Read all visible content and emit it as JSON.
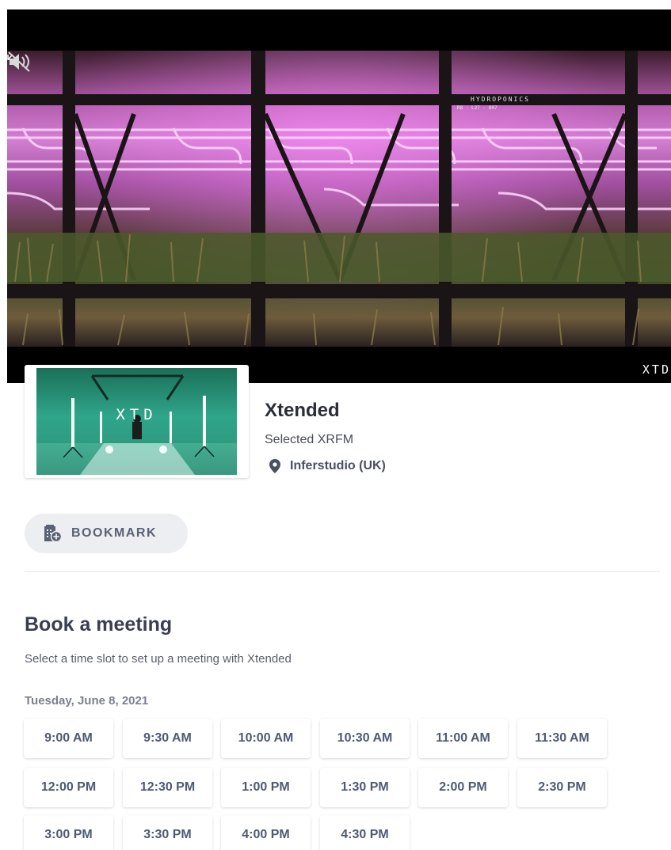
{
  "hero": {
    "video_overlay_text": "HYDROPONICS",
    "video_overlay_code": "R8 - L27 - 807",
    "brand_corner": "XTD"
  },
  "exhibitor": {
    "logo_text": "XTD",
    "name": "Xtended",
    "subtitle": "Selected XRFM",
    "location": "Inferstudio (UK)"
  },
  "actions": {
    "bookmark_label": "BOOKMARK"
  },
  "booking": {
    "title": "Book a meeting",
    "description": "Select a time slot to set up a meeting with Xtended",
    "date": "Tuesday, June 8, 2021",
    "slots": [
      "9:00 AM",
      "9:30 AM",
      "10:00 AM",
      "10:30 AM",
      "11:00 AM",
      "11:30 AM",
      "12:00 PM",
      "12:30 PM",
      "1:00 PM",
      "1:30 PM",
      "2:00 PM",
      "2:30 PM",
      "3:00 PM",
      "3:30 PM",
      "4:00 PM",
      "4:30 PM"
    ]
  },
  "colors": {
    "accent_text": "#4e5a73",
    "button_bg": "#eceef1",
    "divider": "#e4e6ea"
  },
  "icons": {
    "mute": "speaker-muted-icon",
    "pin": "map-pin-icon",
    "bookmark": "building-add-icon",
    "expand": "expand-icon"
  }
}
